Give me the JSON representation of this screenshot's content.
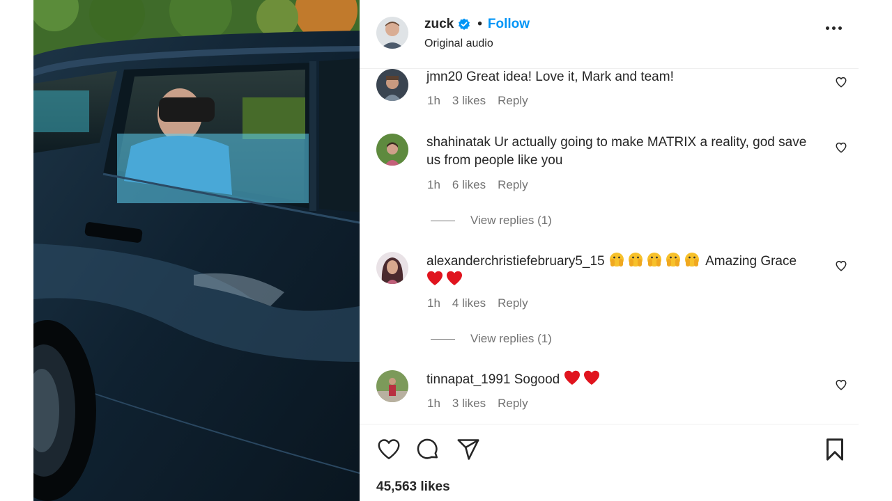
{
  "post": {
    "username": "zuck",
    "follow_label": "Follow",
    "separator": "•",
    "audio_label": "Original audio",
    "likes_text": "45,563 likes"
  },
  "comments": [
    {
      "username": "jmn20",
      "text": "Great idea! Love it, Mark and team!",
      "time": "1h",
      "likes": "3 likes",
      "reply_label": "Reply"
    },
    {
      "username": "shahinatak",
      "text": "Ur actually going to make MATRIX a reality, god save us from people like you",
      "time": "1h",
      "likes": "6 likes",
      "reply_label": "Reply",
      "view_replies": "View replies (1)"
    },
    {
      "username": "alexanderchristiefebruary5_15",
      "text": "Amazing Grace",
      "time": "1h",
      "likes": "4 likes",
      "reply_label": "Reply",
      "view_replies": "View replies (1)"
    },
    {
      "username": "tinnapat_1991",
      "text": "Sogood",
      "time": "1h",
      "likes": "3 likes",
      "reply_label": "Reply"
    }
  ],
  "icons": {
    "verified": "verified-badge-icon",
    "more": "more-options-icon",
    "like": "heart-icon",
    "comment": "comment-bubble-icon",
    "share": "paper-plane-icon",
    "save": "bookmark-icon"
  },
  "colors": {
    "accent": "#0095f6",
    "text": "#262626",
    "muted": "#737373",
    "emoji_heart": "#e0141e"
  }
}
